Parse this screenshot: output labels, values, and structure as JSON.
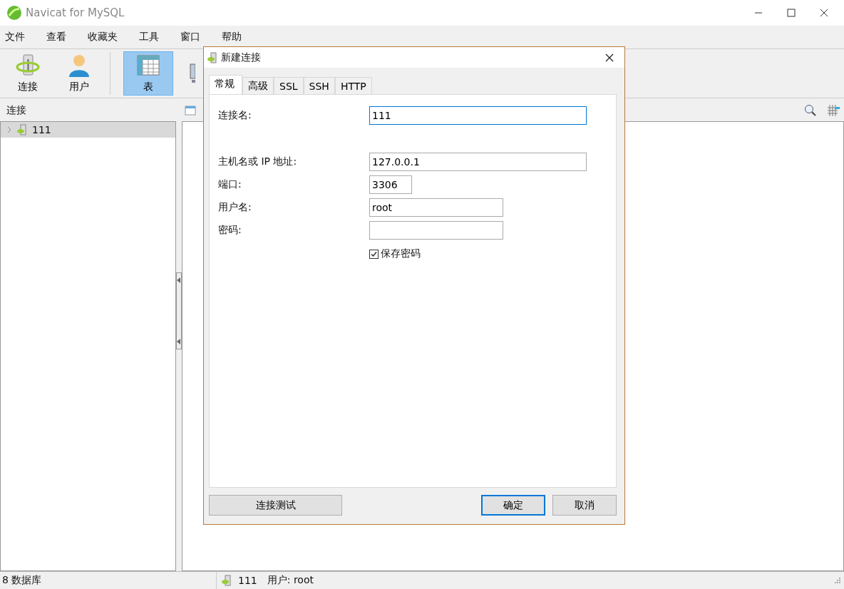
{
  "window": {
    "title": "Navicat for MySQL"
  },
  "menu": [
    "文件",
    "查看",
    "收藏夹",
    "工具",
    "窗口",
    "帮助"
  ],
  "toolbar": [
    {
      "label": "连接",
      "kind": "connection",
      "selected": false
    },
    {
      "label": "用户",
      "kind": "user",
      "selected": false
    },
    {
      "label": "表",
      "kind": "table",
      "selected": true
    },
    {
      "kind": "view",
      "selected": false
    }
  ],
  "sidebar": {
    "title": "连接",
    "items": [
      {
        "label": "111",
        "expanded": false,
        "selected": true
      }
    ]
  },
  "dialog": {
    "title": "新建连接",
    "tabs": [
      {
        "label": "常规",
        "selected": true
      },
      {
        "label": "高级",
        "selected": false
      },
      {
        "label": "SSL",
        "selected": false
      },
      {
        "label": "SSH",
        "selected": false
      },
      {
        "label": "HTTP",
        "selected": false
      }
    ],
    "fields": [
      {
        "label": "连接名:",
        "value": "111",
        "kind": "name",
        "focused": true
      },
      {
        "label": "主机名或 IP 地址:",
        "value": "127.0.0.1",
        "kind": "host",
        "focused": false
      },
      {
        "label": "端口:",
        "value": "3306",
        "kind": "port",
        "focused": false
      },
      {
        "label": "用户名:",
        "value": "root",
        "kind": "text",
        "focused": false
      },
      {
        "label": "密码:",
        "kind": "password",
        "focused": false
      }
    ],
    "checkbox": {
      "label": "保存密码",
      "checked": true
    },
    "buttons": [
      {
        "label": "连接测试",
        "kind": "secondary"
      },
      {
        "label": "确定",
        "kind": "default"
      },
      {
        "label": "取消",
        "kind": "secondary"
      }
    ]
  },
  "status_bar": {
    "left": "8 数据库",
    "connection": "111",
    "user": "用户: root"
  }
}
